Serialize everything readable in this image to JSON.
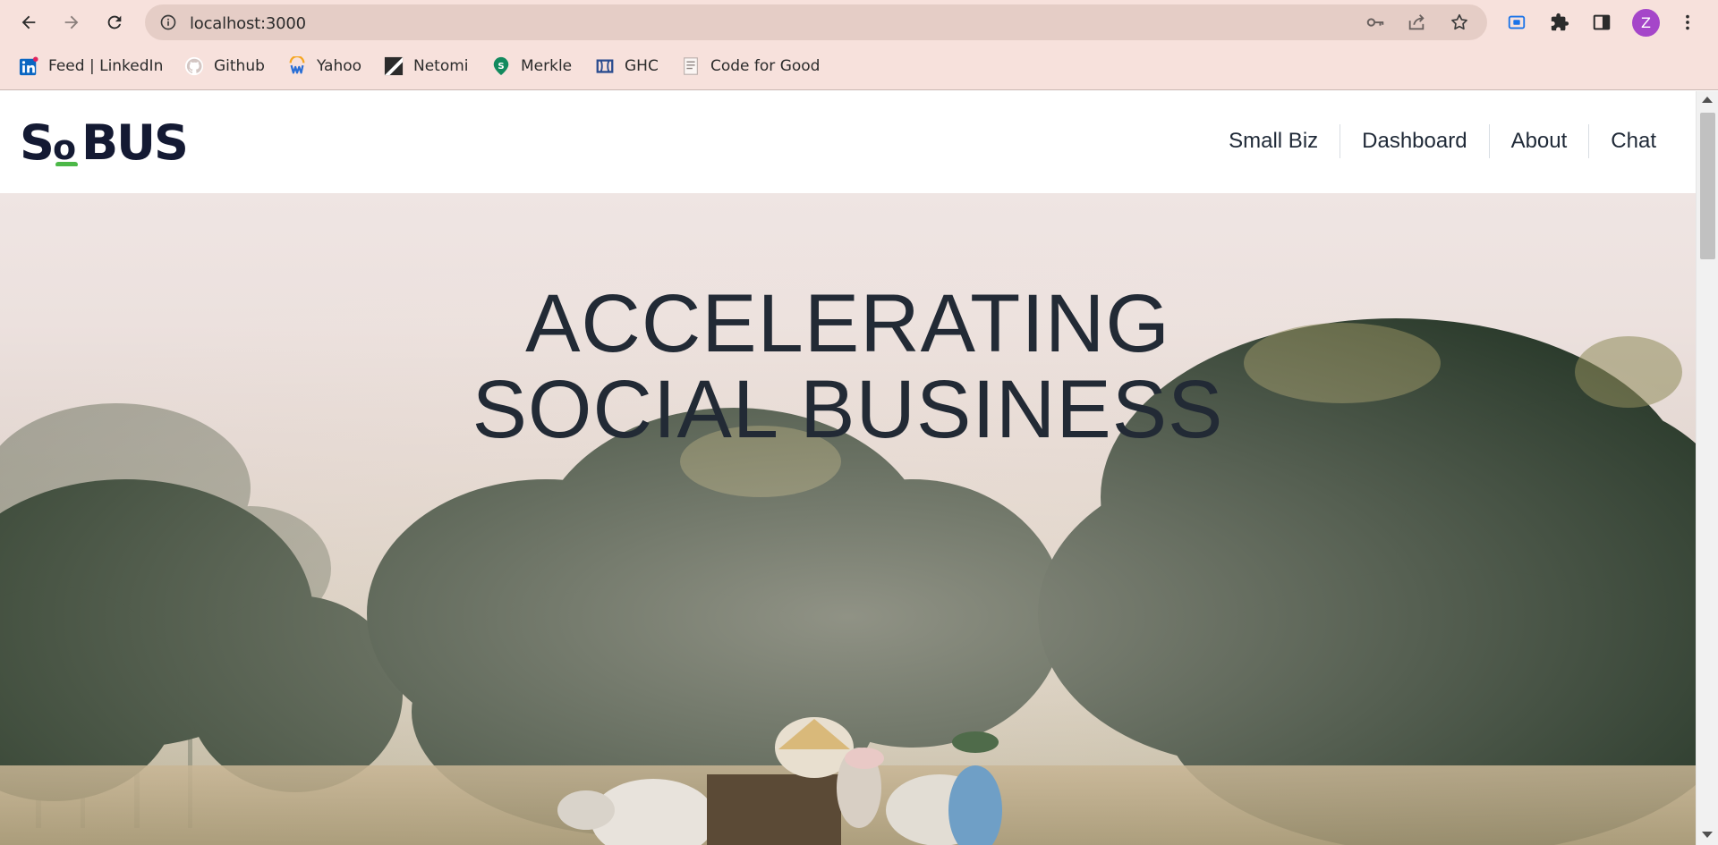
{
  "browser": {
    "url": "localhost:3000",
    "profile_initial": "Z",
    "profile_color": "#a546c9",
    "icons": {
      "back": "back-arrow-icon",
      "forward": "forward-arrow-icon",
      "reload": "reload-icon",
      "site_info": "info-icon",
      "password": "key-icon",
      "share": "share-icon",
      "bookmark": "star-icon",
      "screencast": "screencast-icon",
      "extensions": "puzzle-icon",
      "side_panel": "side-panel-icon",
      "menu": "kebab-menu-icon"
    },
    "bookmarks": [
      {
        "label": "Feed | LinkedIn",
        "icon": "linkedin-icon"
      },
      {
        "label": "Github",
        "icon": "github-icon"
      },
      {
        "label": "Yahoo",
        "icon": "yahoo-icon"
      },
      {
        "label": "Netomi",
        "icon": "netomi-icon"
      },
      {
        "label": "Merkle",
        "icon": "merkle-icon"
      },
      {
        "label": "GHC",
        "icon": "ghc-icon"
      },
      {
        "label": "Code for Good",
        "icon": "page-icon"
      }
    ]
  },
  "site": {
    "logo_text": "SOBUS",
    "logo_accent": "#4cb848",
    "nav": [
      "Small Biz",
      "Dashboard",
      "About",
      "Chat"
    ],
    "hero": {
      "line1": "ACCELERATING",
      "line2": "SOCIAL BUSINESS"
    },
    "colors": {
      "text_dark": "#222a35",
      "header_bg": "#ffffff"
    }
  }
}
